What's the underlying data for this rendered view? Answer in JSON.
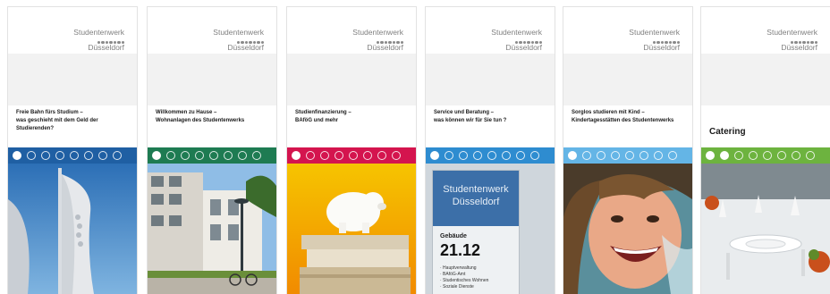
{
  "logo": {
    "line1": "Studentenwerk",
    "line2": "Düsseldorf"
  },
  "brochures": [
    {
      "title": "Freie Bahn fürs Studium –\nwas geschieht mit dem Geld der\nStudierenden?",
      "band_color": "#1f5fa3"
    },
    {
      "title": "Willkommen zu Hause –\nWohnanlagen des Studentenwerks",
      "band_color": "#1e7b52"
    },
    {
      "title": "Studienfinanzierung –\nBAföG und mehr",
      "band_color": "#d4144e"
    },
    {
      "title": "Service und Beratung –\nwas können wir für Sie tun ?",
      "band_color": "#2e8cd0"
    },
    {
      "title": "Sorglos studieren mit Kind –\nKindertagesstätten des Studentenwerks",
      "band_color": "#64b5e6"
    },
    {
      "title": "Catering",
      "band_color": "#6db33f"
    }
  ],
  "sign": {
    "header_line1": "Studentenwerk",
    "header_line2": "Düsseldorf",
    "label": "Gebäude",
    "number": "21.12",
    "items": [
      "· Hauptverwaltung",
      "· BAföG-Amt",
      "· Studentisches Wohnen",
      "· Soziale Dienste"
    ]
  }
}
